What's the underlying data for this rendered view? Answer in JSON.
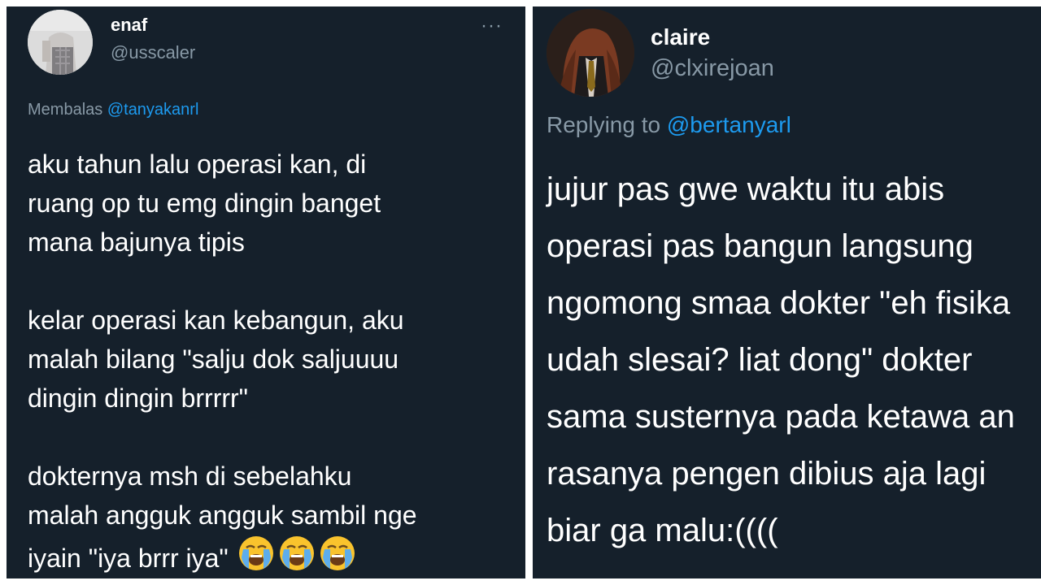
{
  "tweets": [
    {
      "name": "enaf",
      "handle": "@usscaler",
      "more_label": "···",
      "reply_prefix": "Membalas",
      "reply_mention": "@tanyakanrl",
      "paragraphs": [
        [
          "aku tahun lalu operasi kan, di",
          "ruang op tu emg dingin banget",
          "mana bajunya tipis"
        ],
        [
          "kelar operasi kan kebangun, aku",
          "malah bilang \"salju dok saljuuuu",
          "dingin dingin brrrrr\""
        ],
        [
          "dokternya msh di sebelahku",
          "malah angguk angguk sambil nge",
          "iyain \"iya brrr iya\""
        ]
      ],
      "emoji": [
        "loudly-crying-face-icon",
        "loudly-crying-face-icon",
        "loudly-crying-face-icon"
      ]
    },
    {
      "name": "claire",
      "handle": "@clxirejoan",
      "reply_prefix": "Replying to",
      "reply_mention": "@bertanyarl",
      "lines": [
        "jujur pas gwe waktu itu abis",
        "operasi pas bangun langsung",
        "ngomong smaa dokter \"eh fisika",
        "udah slesai? liat dong\" dokter",
        "sama susternya pada ketawa an",
        "rasanya pengen dibius aja lagi",
        "biar ga malu:(((("
      ]
    }
  ],
  "colors": {
    "background": "#15202b",
    "text": "#ffffff",
    "secondary": "#8899a6",
    "mention": "#1d9bf0"
  }
}
